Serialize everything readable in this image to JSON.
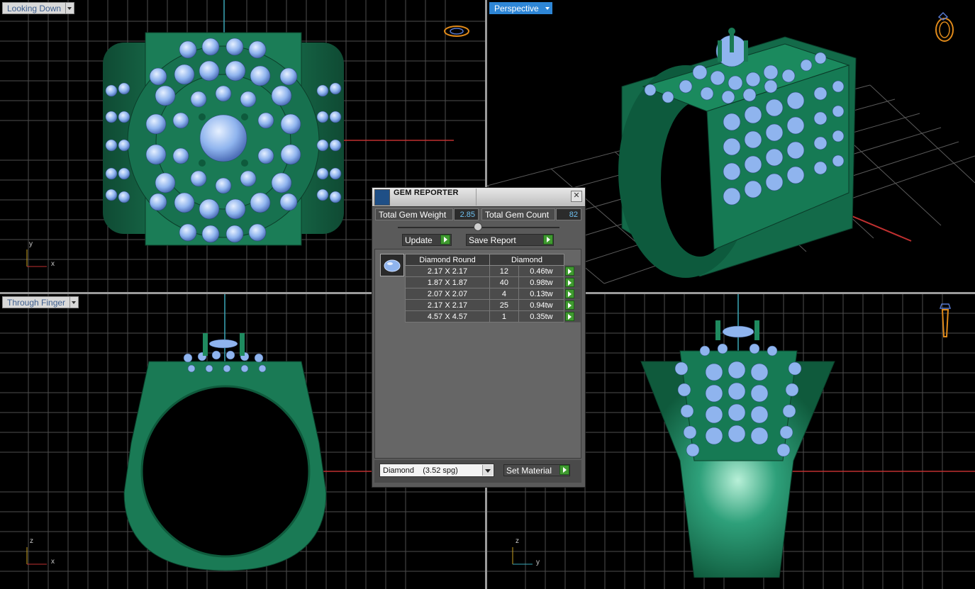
{
  "viewports": {
    "top_left": {
      "label": "Looking Down",
      "axis_h": "x",
      "axis_v": "y"
    },
    "top_right": {
      "label": "Perspective"
    },
    "bottom_left": {
      "label": "Through Finger",
      "axis_h": "x",
      "axis_v": "z"
    },
    "bottom_right": {
      "axis_h": "y",
      "axis_v": "z"
    }
  },
  "gem_reporter": {
    "title": "GEM REPORTER",
    "close": "✕",
    "total_weight_label": "Total Gem Weight",
    "total_weight_value": "2.85",
    "total_count_label": "Total Gem Count",
    "total_count_value": "82",
    "update_label": "Update",
    "save_label": "Save Report",
    "columns": [
      "Diamond Round",
      "Diamond"
    ],
    "rows": [
      {
        "size": "2.17 X 2.17",
        "count": "12",
        "weight": "0.46tw"
      },
      {
        "size": "1.87 X 1.87",
        "count": "40",
        "weight": "0.98tw"
      },
      {
        "size": "2.07 X 2.07",
        "count": "4",
        "weight": "0.13tw"
      },
      {
        "size": "2.17 X 2.17",
        "count": "25",
        "weight": "0.94tw"
      },
      {
        "size": "4.57 X 4.57",
        "count": "1",
        "weight": "0.35tw"
      }
    ],
    "material_select": "Diamond    (3.52 spg)",
    "set_material_label": "Set Material"
  },
  "colors": {
    "metal": "#1a7a55",
    "gem": "#8fb4ee",
    "grid": "#5a5a5a",
    "axis_red": "#c03030",
    "axis_cyan": "#3aa8b8",
    "active_tab": "#2e86d6"
  }
}
